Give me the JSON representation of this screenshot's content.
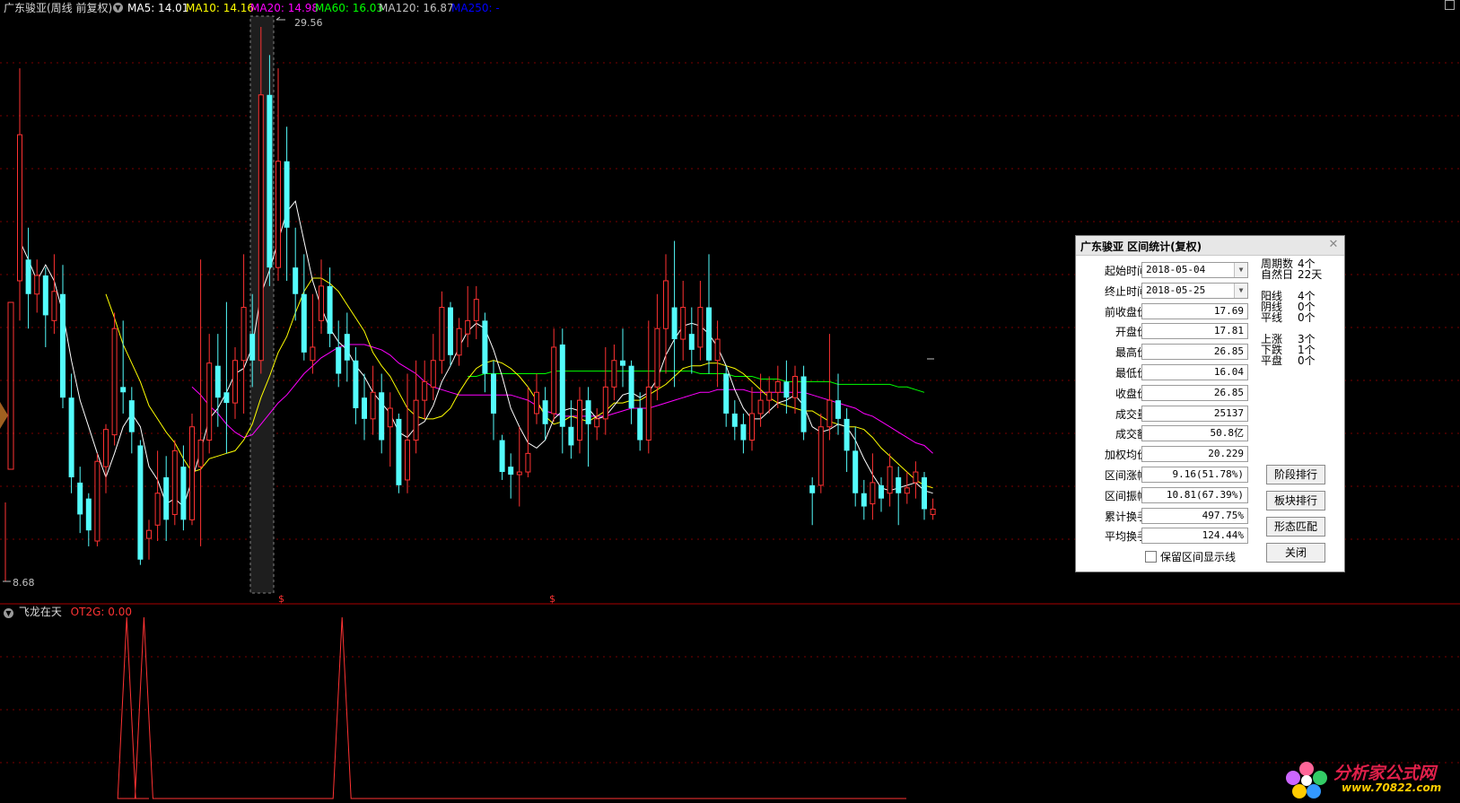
{
  "header": {
    "title": "广东骏亚(周线 前复权)",
    "ma": [
      {
        "label": "MA5: 14.01",
        "color": "#ffffff"
      },
      {
        "label": "MA10: 14.16",
        "color": "#ffff00"
      },
      {
        "label": "MA20: 14.98",
        "color": "#ff00ff"
      },
      {
        "label": "MA60: 16.03",
        "color": "#00ff00"
      },
      {
        "label": "MA120: 16.87",
        "color": "#c0c0c0"
      },
      {
        "label": "MA250: -",
        "color": "#0000ff"
      }
    ]
  },
  "chart_data": {
    "type": "candlestick",
    "axis_annotations": {
      "high_marker": "29.56",
      "low_marker": "8.68"
    },
    "range_marks": [
      "$",
      "$"
    ],
    "notes": "Weekly candlestick chart with moving averages; candles approximate.",
    "candles": [
      {
        "o": 20.0,
        "c": 25.5,
        "h": 28.0,
        "l": 18.5
      },
      {
        "o": 20.8,
        "c": 19.5,
        "h": 22.0,
        "l": 18.2
      },
      {
        "o": 19.5,
        "c": 20.2,
        "h": 20.8,
        "l": 18.8
      },
      {
        "o": 20.2,
        "c": 18.7,
        "h": 20.5,
        "l": 17.5
      },
      {
        "o": 18.5,
        "c": 19.6,
        "h": 21.0,
        "l": 18.0
      },
      {
        "o": 19.5,
        "c": 15.6,
        "h": 20.6,
        "l": 15.2
      },
      {
        "o": 15.6,
        "c": 12.6,
        "h": 16.5,
        "l": 12.0
      },
      {
        "o": 12.4,
        "c": 11.2,
        "h": 13.0,
        "l": 10.5
      },
      {
        "o": 11.8,
        "c": 10.6,
        "h": 12.0,
        "l": 10.0
      },
      {
        "o": 10.2,
        "c": 13.2,
        "h": 13.5,
        "l": 10.0
      },
      {
        "o": 13.0,
        "c": 14.4,
        "h": 14.6,
        "l": 12.0
      },
      {
        "o": 14.2,
        "c": 18.2,
        "h": 18.8,
        "l": 13.8
      },
      {
        "o": 16.0,
        "c": 15.8,
        "h": 18.5,
        "l": 15.0
      },
      {
        "o": 15.5,
        "c": 14.3,
        "h": 16.0,
        "l": 13.5
      },
      {
        "o": 13.8,
        "c": 9.5,
        "h": 14.0,
        "l": 9.3
      },
      {
        "o": 10.3,
        "c": 10.6,
        "h": 11.0,
        "l": 9.5
      },
      {
        "o": 10.8,
        "c": 12.0,
        "h": 13.6,
        "l": 10.2
      },
      {
        "o": 12.6,
        "c": 11.0,
        "h": 13.4,
        "l": 10.2
      },
      {
        "o": 11.2,
        "c": 13.6,
        "h": 14.0,
        "l": 10.8
      },
      {
        "o": 13.0,
        "c": 11.0,
        "h": 13.8,
        "l": 10.6
      },
      {
        "o": 11.0,
        "c": 14.5,
        "h": 15.0,
        "l": 10.8
      },
      {
        "o": 13.0,
        "c": 14.0,
        "h": 20.8,
        "l": 10.0
      },
      {
        "o": 14.0,
        "c": 16.9,
        "h": 18.0,
        "l": 13.5
      },
      {
        "o": 16.8,
        "c": 15.6,
        "h": 18.0,
        "l": 14.5
      },
      {
        "o": 15.8,
        "c": 15.4,
        "h": 19.2,
        "l": 13.5
      },
      {
        "o": 15.4,
        "c": 17.0,
        "h": 17.5,
        "l": 14.8
      },
      {
        "o": 17.0,
        "c": 19.0,
        "h": 21.0,
        "l": 15.0
      },
      {
        "o": 18.0,
        "c": 17.0,
        "h": 19.5,
        "l": 16.0
      },
      {
        "o": 17.0,
        "c": 27.0,
        "h": 29.56,
        "l": 16.5
      },
      {
        "o": 27.0,
        "c": 20.5,
        "h": 28.5,
        "l": 19.8
      },
      {
        "o": 20.5,
        "c": 24.5,
        "h": 28.0,
        "l": 20.0
      },
      {
        "o": 24.5,
        "c": 22.0,
        "h": 25.8,
        "l": 20.0
      },
      {
        "o": 20.5,
        "c": 19.5,
        "h": 22.0,
        "l": 18.5
      },
      {
        "o": 19.5,
        "c": 17.3,
        "h": 21.0,
        "l": 17.0
      },
      {
        "o": 17.0,
        "c": 17.5,
        "h": 19.5,
        "l": 16.5
      },
      {
        "o": 18.5,
        "c": 19.8,
        "h": 20.8,
        "l": 18.0
      },
      {
        "o": 19.8,
        "c": 18.0,
        "h": 20.5,
        "l": 17.5
      },
      {
        "o": 17.5,
        "c": 16.5,
        "h": 18.5,
        "l": 16.0
      },
      {
        "o": 18.0,
        "c": 17.0,
        "h": 18.8,
        "l": 16.2
      },
      {
        "o": 17.0,
        "c": 15.2,
        "h": 17.5,
        "l": 14.6
      },
      {
        "o": 15.6,
        "c": 14.8,
        "h": 16.5,
        "l": 14.0
      },
      {
        "o": 14.8,
        "c": 15.8,
        "h": 16.8,
        "l": 14.2
      },
      {
        "o": 15.8,
        "c": 14.0,
        "h": 16.5,
        "l": 13.5
      },
      {
        "o": 14.5,
        "c": 15.2,
        "h": 15.8,
        "l": 13.0
      },
      {
        "o": 14.8,
        "c": 12.3,
        "h": 15.0,
        "l": 12.0
      },
      {
        "o": 12.5,
        "c": 14.0,
        "h": 16.5,
        "l": 12.0
      },
      {
        "o": 14.0,
        "c": 15.5,
        "h": 17.0,
        "l": 13.5
      },
      {
        "o": 15.5,
        "c": 16.2,
        "h": 17.0,
        "l": 14.8
      },
      {
        "o": 16.0,
        "c": 17.0,
        "h": 18.0,
        "l": 15.5
      },
      {
        "o": 17.0,
        "c": 19.0,
        "h": 19.6,
        "l": 16.5
      },
      {
        "o": 19.0,
        "c": 17.2,
        "h": 19.2,
        "l": 16.8
      },
      {
        "o": 17.2,
        "c": 18.2,
        "h": 18.6,
        "l": 16.8
      },
      {
        "o": 18.0,
        "c": 18.5,
        "h": 19.8,
        "l": 17.5
      },
      {
        "o": 18.5,
        "c": 19.3,
        "h": 19.8,
        "l": 17.8
      },
      {
        "o": 18.5,
        "c": 16.5,
        "h": 18.8,
        "l": 15.8
      },
      {
        "o": 16.5,
        "c": 15.0,
        "h": 17.0,
        "l": 14.0
      },
      {
        "o": 14.0,
        "c": 12.8,
        "h": 14.2,
        "l": 12.5
      },
      {
        "o": 13.0,
        "c": 12.7,
        "h": 13.5,
        "l": 11.8
      },
      {
        "o": 12.7,
        "c": 12.8,
        "h": 14.5,
        "l": 11.5
      },
      {
        "o": 12.8,
        "c": 13.5,
        "h": 16.0,
        "l": 12.6
      },
      {
        "o": 15.0,
        "c": 15.8,
        "h": 16.5,
        "l": 14.6
      },
      {
        "o": 15.5,
        "c": 14.6,
        "h": 16.0,
        "l": 14.0
      },
      {
        "o": 15.0,
        "c": 17.5,
        "h": 18.2,
        "l": 14.7
      },
      {
        "o": 17.6,
        "c": 14.5,
        "h": 18.2,
        "l": 13.5
      },
      {
        "o": 14.5,
        "c": 13.8,
        "h": 15.5,
        "l": 13.3
      },
      {
        "o": 14.0,
        "c": 15.5,
        "h": 16.0,
        "l": 13.5
      },
      {
        "o": 15.5,
        "c": 14.6,
        "h": 16.0,
        "l": 13.0
      },
      {
        "o": 14.5,
        "c": 14.8,
        "h": 15.2,
        "l": 14.0
      },
      {
        "o": 14.8,
        "c": 16.0,
        "h": 17.5,
        "l": 14.2
      },
      {
        "o": 16.0,
        "c": 17.0,
        "h": 17.6,
        "l": 15.5
      },
      {
        "o": 17.0,
        "c": 16.8,
        "h": 18.2,
        "l": 16.0
      },
      {
        "o": 16.8,
        "c": 15.2,
        "h": 17.0,
        "l": 14.6
      },
      {
        "o": 15.2,
        "c": 14.0,
        "h": 15.8,
        "l": 13.6
      },
      {
        "o": 14.0,
        "c": 16.0,
        "h": 18.5,
        "l": 13.5
      },
      {
        "o": 16.0,
        "c": 18.2,
        "h": 19.5,
        "l": 15.5
      },
      {
        "o": 18.2,
        "c": 20.0,
        "h": 21.0,
        "l": 16.5
      },
      {
        "o": 19.0,
        "c": 17.8,
        "h": 21.5,
        "l": 16.0
      },
      {
        "o": 17.8,
        "c": 19.0,
        "h": 20.0,
        "l": 17.0
      },
      {
        "o": 18.0,
        "c": 17.4,
        "h": 19.0,
        "l": 16.5
      },
      {
        "o": 17.5,
        "c": 19.0,
        "h": 20.0,
        "l": 17.0
      },
      {
        "o": 19.0,
        "c": 17.0,
        "h": 21.0,
        "l": 16.5
      },
      {
        "o": 17.0,
        "c": 17.8,
        "h": 18.5,
        "l": 16.0
      },
      {
        "o": 16.5,
        "c": 15.0,
        "h": 16.8,
        "l": 14.5
      },
      {
        "o": 15.0,
        "c": 14.5,
        "h": 15.5,
        "l": 14.0
      },
      {
        "o": 14.6,
        "c": 14.0,
        "h": 15.0,
        "l": 13.5
      },
      {
        "o": 14.0,
        "c": 15.0,
        "h": 16.0,
        "l": 13.6
      },
      {
        "o": 15.0,
        "c": 15.5,
        "h": 16.5,
        "l": 14.5
      },
      {
        "o": 15.5,
        "c": 15.8,
        "h": 16.4,
        "l": 15.0
      },
      {
        "o": 15.8,
        "c": 16.2,
        "h": 16.8,
        "l": 15.2
      },
      {
        "o": 16.2,
        "c": 15.6,
        "h": 17.0,
        "l": 15.0
      },
      {
        "o": 15.6,
        "c": 16.4,
        "h": 16.8,
        "l": 15.0
      },
      {
        "o": 16.4,
        "c": 14.3,
        "h": 16.8,
        "l": 14.0
      },
      {
        "o": 12.3,
        "c": 12.0,
        "h": 12.6,
        "l": 10.8
      },
      {
        "o": 12.3,
        "c": 14.5,
        "h": 15.0,
        "l": 12.0
      },
      {
        "o": 14.5,
        "c": 15.5,
        "h": 18.0,
        "l": 14.0
      },
      {
        "o": 15.5,
        "c": 14.8,
        "h": 16.5,
        "l": 14.2
      },
      {
        "o": 14.8,
        "c": 13.6,
        "h": 15.2,
        "l": 12.8
      },
      {
        "o": 13.6,
        "c": 12.0,
        "h": 14.5,
        "l": 11.5
      },
      {
        "o": 12.0,
        "c": 11.5,
        "h": 12.5,
        "l": 11.0
      },
      {
        "o": 11.6,
        "c": 12.4,
        "h": 13.5,
        "l": 11.0
      },
      {
        "o": 12.3,
        "c": 11.8,
        "h": 12.6,
        "l": 11.3
      },
      {
        "o": 12.0,
        "c": 13.0,
        "h": 13.5,
        "l": 11.5
      },
      {
        "o": 12.6,
        "c": 12.0,
        "h": 13.0,
        "l": 10.8
      },
      {
        "o": 12.0,
        "c": 12.2,
        "h": 12.8,
        "l": 11.6
      },
      {
        "o": 12.4,
        "c": 12.8,
        "h": 13.2,
        "l": 11.8
      },
      {
        "o": 12.6,
        "c": 11.4,
        "h": 12.8,
        "l": 11.0
      },
      {
        "o": 11.2,
        "c": 11.4,
        "h": 11.8,
        "l": 11.0
      }
    ],
    "ma5_color": "#ffffff",
    "ma10_color": "#ffff00",
    "ma20_color": "#ff00ff",
    "ma60_color": "#00ff00",
    "ma5": [
      21.5,
      20.8,
      20.0,
      20.6,
      20.0,
      18.8,
      17.0,
      15.5,
      14.5,
      13.5,
      12.6,
      13.5,
      14.5,
      15.0,
      14.5,
      13.0,
      12.5,
      11.6,
      11.8,
      11.5,
      12.5,
      13.6,
      14.8,
      15.2,
      15.8,
      16.5,
      16.7,
      17.5,
      19.5,
      20.4,
      21.5,
      22.6,
      23.0,
      21.5,
      20.0,
      19.0,
      18.2,
      17.7,
      17.4,
      16.8,
      16.4,
      15.8,
      15.4,
      15.0,
      14.3,
      14.1,
      14.5,
      14.7,
      15.3,
      16.2,
      16.8,
      17.5,
      18.1,
      18.4,
      18.2,
      17.4,
      16.4,
      15.2,
      14.5,
      13.9,
      13.7,
      14.0,
      14.8,
      15.1,
      15.2,
      15.1,
      15.2,
      14.8,
      14.9,
      15.3,
      15.7,
      15.8,
      15.6,
      15.8,
      16.3,
      17.2,
      17.8,
      18.3,
      18.4,
      18.3,
      18.0,
      17.5,
      16.8,
      15.9,
      15.2,
      14.8,
      14.8,
      15.1,
      15.4,
      15.5,
      15.7,
      15.3,
      14.5,
      14.3,
      14.4,
      14.6,
      14.5,
      14.0,
      13.3,
      12.7,
      12.2,
      12.1,
      12.2,
      12.3,
      12.4,
      12.1,
      12.0
    ],
    "ma10": [
      null,
      null,
      null,
      null,
      null,
      null,
      null,
      null,
      null,
      null,
      19.5,
      18.6,
      17.6,
      16.9,
      16.2,
      15.3,
      14.8,
      14.3,
      13.9,
      13.3,
      12.8,
      12.9,
      13.3,
      13.4,
      13.5,
      13.6,
      14.0,
      14.6,
      15.6,
      16.4,
      17.3,
      17.9,
      18.8,
      19.6,
      20.1,
      20.1,
      19.9,
      19.6,
      19.1,
      18.6,
      18.1,
      17.3,
      16.8,
      16.4,
      15.8,
      15.2,
      14.9,
      14.8,
      14.8,
      14.9,
      15.2,
      15.8,
      16.3,
      16.7,
      16.9,
      17.0,
      16.9,
      16.7,
      16.4,
      16.0,
      15.5,
      14.9,
      14.6,
      14.7,
      14.9,
      14.8,
      14.7,
      14.9,
      15.1,
      15.4,
      15.4,
      15.5,
      15.5,
      15.7,
      15.9,
      16.1,
      16.4,
      16.7,
      16.8,
      16.8,
      16.9,
      16.9,
      16.8,
      16.7,
      16.5,
      16.2,
      15.9,
      15.6,
      15.4,
      15.3,
      15.2,
      15.1,
      15.1,
      14.9,
      14.7,
      14.6,
      14.5,
      14.5,
      14.4,
      14.1,
      13.7,
      13.4,
      13.1,
      12.8,
      12.5,
      12.3,
      12.2
    ],
    "ma20": [
      null,
      null,
      null,
      null,
      null,
      null,
      null,
      null,
      null,
      null,
      null,
      null,
      null,
      null,
      null,
      null,
      null,
      null,
      null,
      null,
      16.0,
      15.7,
      15.3,
      15.0,
      14.6,
      14.3,
      14.1,
      14.2,
      14.6,
      15.0,
      15.4,
      15.7,
      16.1,
      16.5,
      16.8,
      17.1,
      17.3,
      17.5,
      17.6,
      17.6,
      17.6,
      17.5,
      17.4,
      17.2,
      16.9,
      16.7,
      16.5,
      16.2,
      16.0,
      15.9,
      15.8,
      15.7,
      15.7,
      15.7,
      15.7,
      15.7,
      15.7,
      15.7,
      15.6,
      15.5,
      15.3,
      15.1,
      15.0,
      14.9,
      14.9,
      14.9,
      14.9,
      14.9,
      14.9,
      15.0,
      15.1,
      15.2,
      15.2,
      15.2,
      15.3,
      15.4,
      15.5,
      15.6,
      15.7,
      15.8,
      15.8,
      15.9,
      15.9,
      15.9,
      15.9,
      15.8,
      15.8,
      15.8,
      15.8,
      15.8,
      15.8,
      15.8,
      15.7,
      15.6,
      15.5,
      15.4,
      15.3,
      15.2,
      15.0,
      14.9,
      14.7,
      14.5,
      14.3,
      14.1,
      13.9,
      13.8,
      13.5
    ],
    "ma60": [
      null,
      null,
      null,
      null,
      null,
      null,
      null,
      null,
      null,
      null,
      null,
      null,
      null,
      null,
      null,
      null,
      null,
      null,
      null,
      null,
      null,
      null,
      null,
      null,
      null,
      null,
      null,
      null,
      null,
      null,
      null,
      null,
      null,
      null,
      null,
      null,
      null,
      null,
      null,
      null,
      null,
      null,
      null,
      null,
      null,
      null,
      null,
      null,
      null,
      null,
      null,
      null,
      16.4,
      16.4,
      16.5,
      16.5,
      16.5,
      16.5,
      16.5,
      16.5,
      16.5,
      16.5,
      16.6,
      16.6,
      16.6,
      16.6,
      16.6,
      16.6,
      16.6,
      16.6,
      16.6,
      16.6,
      16.6,
      16.6,
      16.6,
      16.6,
      16.6,
      16.6,
      16.6,
      16.5,
      16.5,
      16.5,
      16.5,
      16.4,
      16.4,
      16.4,
      16.3,
      16.3,
      16.3,
      16.2,
      16.2,
      16.2,
      16.2,
      16.2,
      16.2,
      16.1,
      16.1,
      16.1,
      16.1,
      16.1,
      16.1,
      16.1,
      16.0,
      16.0,
      15.9,
      15.8
    ]
  },
  "indicator": {
    "name": "飞龙在天",
    "value_label": "OT2G: 0.00",
    "value_color": "#ff3333",
    "spike_bars": [
      12,
      14,
      37
    ]
  },
  "dialog": {
    "title": "广东骏亚 区间统计(复权)",
    "rows": [
      {
        "label": "起始时间",
        "value": "2018-05-04",
        "dropdown": true
      },
      {
        "label": "终止时间",
        "value": "2018-05-25",
        "dropdown": true
      },
      {
        "label": "前收盘价",
        "value": "17.69"
      },
      {
        "label": "开盘价",
        "value": "17.81"
      },
      {
        "label": "最高价",
        "value": "26.85"
      },
      {
        "label": "最低价",
        "value": "16.04"
      },
      {
        "label": "收盘价",
        "value": "26.85"
      },
      {
        "label": "成交量",
        "value": "25137"
      },
      {
        "label": "成交额",
        "value": "50.8亿"
      },
      {
        "label": "加权均价",
        "value": "20.229"
      },
      {
        "label": "区间涨幅",
        "value": "9.16(51.78%)"
      },
      {
        "label": "区间振幅",
        "value": "10.81(67.39%)"
      },
      {
        "label": "累计换手",
        "value": "497.75%"
      },
      {
        "label": "平均换手",
        "value": "124.44%"
      }
    ],
    "stats": [
      {
        "k": "周期数",
        "v": "4个"
      },
      {
        "k": "自然日",
        "v": "22天"
      },
      {
        "k": "阳线",
        "v": "4个"
      },
      {
        "k": "阴线",
        "v": "0个"
      },
      {
        "k": "平线",
        "v": "0个"
      },
      {
        "k": "上涨",
        "v": "3个"
      },
      {
        "k": "下跌",
        "v": "1个"
      },
      {
        "k": "平盘",
        "v": "0个"
      }
    ],
    "buttons": [
      "阶段排行",
      "板块排行",
      "形态匹配",
      "关闭"
    ],
    "checkbox_label": "保留区间显示线"
  },
  "watermark": {
    "text": "分析家公式网",
    "url": "www.70822.com"
  }
}
